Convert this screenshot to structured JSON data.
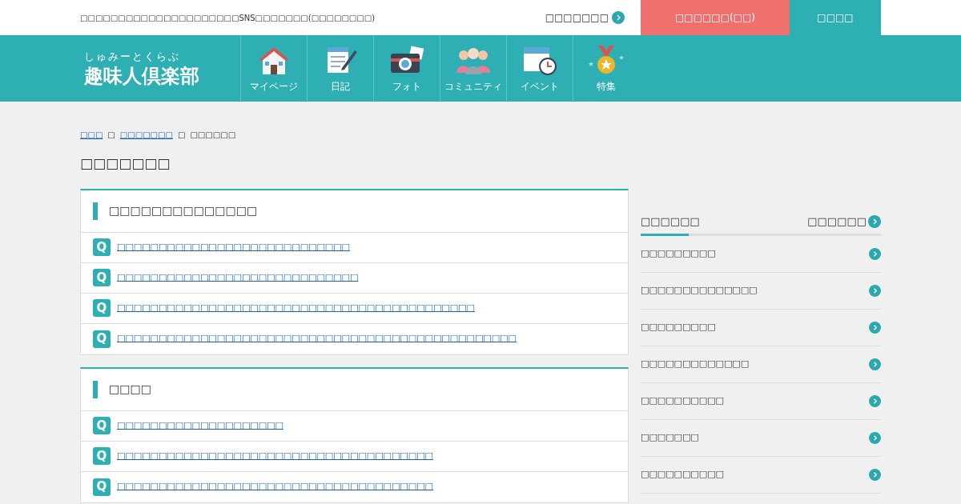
{
  "top_bar": {
    "tagline": "□□□□□□□□□□□□□□□□□□□□□SNS□□□□□□□(□□□□□□□□)",
    "login_link": "□□□□□□□",
    "register_button": "□□□□□□(□□)",
    "login_button": "□□□□"
  },
  "logo": {
    "ruby": "しゅみーとくらぶ",
    "name": "趣味人倶楽部"
  },
  "nav": [
    {
      "kind": "house",
      "label": "マイページ"
    },
    {
      "kind": "diary",
      "label": "日記"
    },
    {
      "kind": "camera",
      "label": "フォト"
    },
    {
      "kind": "people",
      "label": "コミュニティ"
    },
    {
      "kind": "calendar",
      "label": "イベント"
    },
    {
      "kind": "medal",
      "label": "特集"
    }
  ],
  "breadcrumb": [
    {
      "label": "□□□",
      "link": true
    },
    {
      "label": "□□□□□□□",
      "link": true
    },
    {
      "label": "□□□□□□",
      "link": false
    }
  ],
  "breadcrumb_separator": "□",
  "page_title": "□□□□□□□",
  "sections": [
    {
      "heading": "□□□□□□□□□□□□□□",
      "questions": [
        {
          "badge": "Q",
          "text": "□□□□□□□□□□□□□□□□□□□□□□□□□□□□"
        },
        {
          "badge": "Q",
          "text": "□□□□□□□□□□□□□□□□□□□□□□□□□□□□□"
        },
        {
          "badge": "Q",
          "text": "□□□□□□□□□□□□□□□□□□□□□□□□□□□□□□□□□□□□□□□□□□□"
        },
        {
          "badge": "Q",
          "text": "□□□□□□□□□□□□□□□□□□□□□□□□□□□□□□□□□□□□□□□□□□□□□□□□"
        }
      ]
    },
    {
      "heading": "□□□□",
      "questions": [
        {
          "badge": "Q",
          "text": "□□□□□□□□□□□□□□□□□□□□"
        },
        {
          "badge": "Q",
          "text": "□□□□□□□□□□□□□□□□□□□□□□□□□□□□□□□□□□□□□□"
        },
        {
          "badge": "Q",
          "text": "□□□□□□□□□□□□□□□□□□□□□□□□□□□□□□□□□□□□□□"
        }
      ]
    }
  ],
  "sidebar": {
    "tab": {
      "label": "□□□□□□",
      "selected": true
    },
    "more_link": "□□□□□□",
    "items": [
      "□□□□□□□□□",
      "□□□□□□□□□□□□□□",
      "□□□□□□□□□",
      "□□□□□□□□□□□□□",
      "□□□□□□□□□□",
      "□□□□□□□",
      "□□□□□□□□□□"
    ]
  }
}
